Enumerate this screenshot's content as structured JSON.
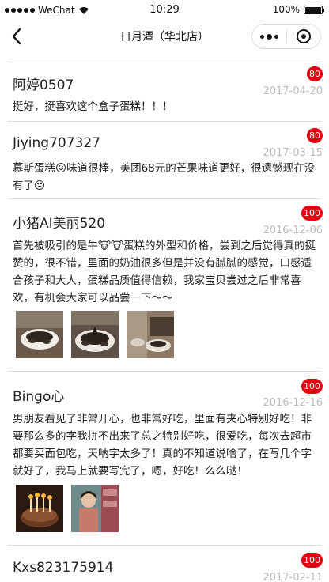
{
  "status_bar": {
    "carrier": "WeChat",
    "time": "10:29",
    "battery": "100%"
  },
  "nav": {
    "title": "日月潭（华北店）"
  },
  "reviews": [
    {
      "user": "阿婷0507",
      "score": "80",
      "date": "2017-04-20",
      "text": "挺好，挺喜欢这个盒子蛋糕！！！"
    },
    {
      "user": "Jiying707327",
      "score": "80",
      "date": "2017-03-15",
      "text": "慕斯蛋糕😖味道很棒，美团68元的芒果味道更好，很遗憾现在没有了☹"
    },
    {
      "user": "小猪AI美丽520",
      "score": "100",
      "date": "2016-12-06",
      "text": "首先被吸引的是牛🐮🐮蛋糕的外型和价格，尝到之后觉得真的挺赞的，很不错，里面的奶油很多但是并没有腻腻的感觉，口感适合孩子和大人，蛋糕品质值得信赖，我家宝贝尝过之后非常喜欢，有机会大家可以品尝一下～～"
    },
    {
      "user": "Bingo心",
      "score": "100",
      "date": "2016-12-16",
      "text": "男朋友看见了非常开心，也非常好吃，里面有夹心特别好吃！非要那么多的字我拼不出来了总之特别好吃，很爱吃，每次去超市都要买面包吃，天呐字太多了！真的不知道说啥了，在写几个字就好了，我马上就要写完了，嗯，好吃！么么哒！"
    },
    {
      "user": "Kxs823175914",
      "score": "100",
      "date": "2017-02-11",
      "text": ""
    }
  ],
  "colors": {
    "badge": "#e0000f",
    "date": "#bbbbbb",
    "divider": "#dddddd"
  }
}
